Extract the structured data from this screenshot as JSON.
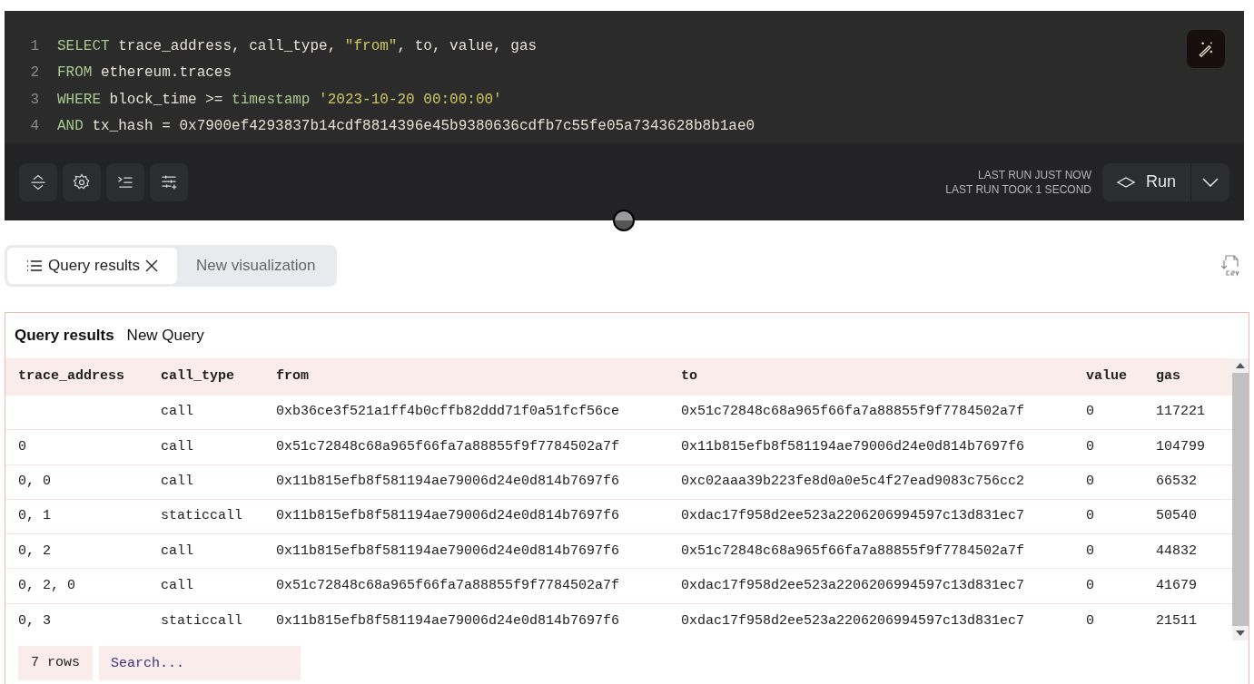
{
  "editor": {
    "lines": [
      {
        "number": "1",
        "tokens": [
          {
            "kind": "keyword",
            "text": "SELECT"
          },
          {
            "kind": "plain",
            "text": " trace_address, call_type, "
          },
          {
            "kind": "string",
            "text": "\"from\""
          },
          {
            "kind": "plain",
            "text": ", to, value, gas"
          }
        ]
      },
      {
        "number": "2",
        "tokens": [
          {
            "kind": "keyword",
            "text": "FROM"
          },
          {
            "kind": "plain",
            "text": " ethereum.traces"
          }
        ]
      },
      {
        "number": "3",
        "tokens": [
          {
            "kind": "keyword",
            "text": "WHERE"
          },
          {
            "kind": "plain",
            "text": " block_time >= "
          },
          {
            "kind": "keyword",
            "text": "timestamp"
          },
          {
            "kind": "string",
            "text": " '2023-10-20 00:00:00'"
          }
        ]
      },
      {
        "number": "4",
        "tokens": [
          {
            "kind": "keyword",
            "text": "AND"
          },
          {
            "kind": "plain",
            "text": " tx_hash = 0x7900ef4293837b14cdf8814396e45b9380636cdfb7c55fe05a7343628b8b1ae0"
          }
        ]
      }
    ]
  },
  "run_status": [
    "LAST RUN JUST NOW",
    "LAST RUN TOOK 1 SECOND"
  ],
  "run_button": "Run",
  "tabs": [
    {
      "label": "Query results",
      "selected": true
    },
    {
      "label": "New visualization",
      "selected": false
    }
  ],
  "results": {
    "title": "Query results",
    "subtitle": "New Query",
    "columns": [
      "trace_address",
      "call_type",
      "from",
      "to",
      "value",
      "gas"
    ],
    "rows": [
      [
        "",
        "call",
        "0xb36ce3f521a1ff4b0cffb82ddd71f0a51fcf56ce",
        "0x51c72848c68a965f66fa7a88855f9f7784502a7f",
        "0",
        "117221"
      ],
      [
        "0",
        "call",
        "0x51c72848c68a965f66fa7a88855f9f7784502a7f",
        "0x11b815efb8f581194ae79006d24e0d814b7697f6",
        "0",
        "104799"
      ],
      [
        "0, 0",
        "call",
        "0x11b815efb8f581194ae79006d24e0d814b7697f6",
        "0xc02aaa39b223fe8d0a0e5c4f27ead9083c756cc2",
        "0",
        "66532"
      ],
      [
        "0, 1",
        "staticcall",
        "0x11b815efb8f581194ae79006d24e0d814b7697f6",
        "0xdac17f958d2ee523a2206206994597c13d831ec7",
        "0",
        "50540"
      ],
      [
        "0, 2",
        "call",
        "0x11b815efb8f581194ae79006d24e0d814b7697f6",
        "0x51c72848c68a965f66fa7a88855f9f7784502a7f",
        "0",
        "44832"
      ],
      [
        "0, 2, 0",
        "call",
        "0x51c72848c68a965f66fa7a88855f9f7784502a7f",
        "0xdac17f958d2ee523a2206206994597c13d831ec7",
        "0",
        "41679"
      ],
      [
        "0, 3",
        "staticcall",
        "0x11b815efb8f581194ae79006d24e0d814b7697f6",
        "0xdac17f958d2ee523a2206206994597c13d831ec7",
        "0",
        "21511"
      ]
    ],
    "row_count": "7 rows",
    "search": {
      "placeholder": "Search..."
    }
  }
}
